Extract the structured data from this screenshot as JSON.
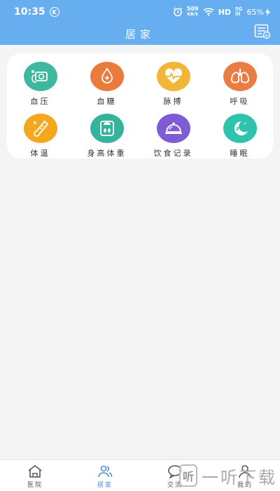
{
  "status_bar": {
    "time": "10:35",
    "k_badge": "K",
    "net_speed": "509",
    "net_unit": "KB/S",
    "hd": "HD",
    "net_top": "5G",
    "net_bottom": "ill",
    "battery": "65%"
  },
  "header": {
    "title": "居家"
  },
  "grid": {
    "items": [
      {
        "label": "血压",
        "icon": "blood-pressure-icon",
        "color": "#3fb8a0"
      },
      {
        "label": "血糖",
        "icon": "blood-sugar-icon",
        "color": "#e97b3d"
      },
      {
        "label": "脉搏",
        "icon": "pulse-icon",
        "color": "#f2b636"
      },
      {
        "label": "呼吸",
        "icon": "lungs-icon",
        "color": "#ea7d46"
      },
      {
        "label": "体温",
        "icon": "thermometer-icon",
        "color": "#f4a81f"
      },
      {
        "label": "身高体重",
        "icon": "scale-icon",
        "color": "#36b39c"
      },
      {
        "label": "饮食记录",
        "icon": "food-cloche-icon",
        "color": "#7f5bd6"
      },
      {
        "label": "睡眠",
        "icon": "moon-icon",
        "color": "#2fc2ad"
      }
    ]
  },
  "tabs": [
    {
      "label": "医院",
      "icon": "home-icon"
    },
    {
      "label": "居家",
      "icon": "users-icon",
      "active": true
    },
    {
      "label": "交流",
      "icon": "chat-icon"
    },
    {
      "label": "我的",
      "icon": "user-icon"
    }
  ],
  "watermark": {
    "badge": "听",
    "text": "一听下载"
  },
  "colors": {
    "primary": "#67aef0",
    "active_tab": "#4c8fd8"
  }
}
